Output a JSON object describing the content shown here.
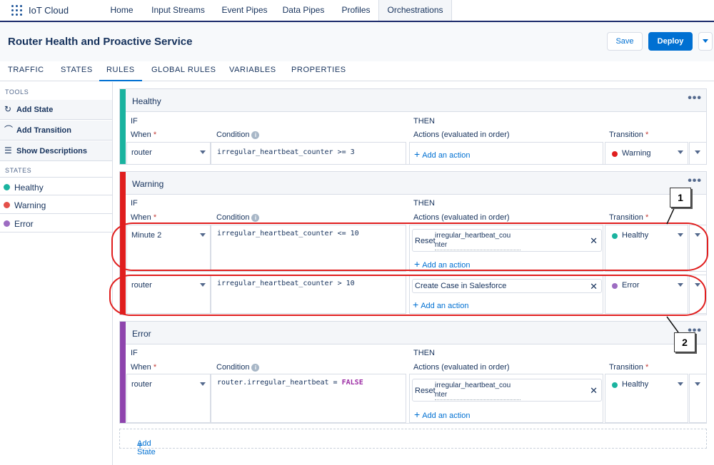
{
  "app": {
    "name": "IoT Cloud"
  },
  "nav": {
    "tabs": [
      "Home",
      "Input Streams",
      "Event Pipes",
      "Data Pipes",
      "Profiles",
      "Orchestrations"
    ]
  },
  "header": {
    "title": "Router Health and Proactive Service",
    "save_label": "Save",
    "deploy_label": "Deploy"
  },
  "subtabs": [
    "TRAFFIC",
    "STATES",
    "RULES",
    "GLOBAL RULES",
    "VARIABLES",
    "PROPERTIES"
  ],
  "sidebar": {
    "tools_header": "TOOLS",
    "tools": [
      "Add State",
      "Add Transition",
      "Show Descriptions"
    ],
    "states_header": "STATES",
    "states": [
      {
        "label": "Healthy",
        "color": "#1ab39f"
      },
      {
        "label": "Warning",
        "color": "#e4504a"
      },
      {
        "label": "Error",
        "color": "#9d6cc2"
      }
    ]
  },
  "columns": {
    "if": "IF",
    "then": "THEN",
    "when": "When",
    "condition": "Condition",
    "actions": "Actions (evaluated in order)",
    "transition": "Transition",
    "required": "*"
  },
  "cards": {
    "healthy": {
      "title": "Healthy",
      "rule1": {
        "when": "router",
        "condition": "irregular_heartbeat_counter >= 3",
        "add_action": "Add an action",
        "transition": "Warning"
      }
    },
    "warning": {
      "title": "Warning",
      "rule1": {
        "when": "Minute 2",
        "condition": "irregular_heartbeat_counter <= 10",
        "action_prefix": "Reset",
        "action_name": "irregular_heartbeat_cou nter",
        "add_action": "Add an action",
        "transition": "Healthy"
      },
      "rule2": {
        "when": "router",
        "condition": "irregular_heartbeat_counter > 10",
        "action_name": "Create Case in Salesforce",
        "add_action": "Add an action",
        "transition": "Error"
      }
    },
    "error": {
      "title": "Error",
      "rule1": {
        "when": "router",
        "condition_prefix": "router.irregular_heartbeat = ",
        "condition_keyword": "FALSE",
        "action_prefix": "Reset",
        "action_name": "irregular_heartbeat_cou nter",
        "add_action": "Add an action",
        "transition": "Healthy"
      }
    }
  },
  "add_state": "Add State",
  "annotations": [
    "1",
    "2"
  ]
}
